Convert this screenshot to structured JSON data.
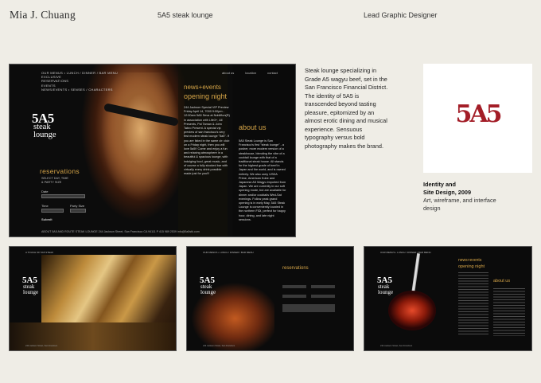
{
  "header": {
    "name": "Mia J. Chuang",
    "project": "5A5 steak lounge",
    "role": "Lead Graphic Designer"
  },
  "main_screenshot": {
    "nav_items": [
      "OUR MENUS  •  LUNCH / DINNER / BAR MENU",
      "EXCLUSIVE",
      "RESERVATIONS",
      "EVENTS",
      "NEWS/EVENTS  •  SENSES / CHARACTERS"
    ],
    "nav_right": [
      "about us",
      "location",
      "contact"
    ],
    "logo_mark": "5A5",
    "logo_word_1": "steak",
    "logo_word_2": "lounge",
    "reservations_title": "reservations",
    "reservations_sub_1": "SELECT DAY, TIME",
    "reservations_sub_2": "& PARTY SIZE",
    "field_date": "Date",
    "field_time": "Time",
    "field_party": "Party Size",
    "submit": "Submit",
    "news_title": "news+events",
    "news_subtitle": "opening night",
    "news_body": "244 Jackson Special VIP Preview Friday April 14, 7000 9:00pm - 12:00am 5A5 Seva at Noblifton(R) in association with Life3+, All Presents, Pal Taman & John Tabro Present. A special vip preview of san francisco's very first modern steak lounge \"5a5\". If you are listed in the same clr: club on a Friday night, then you will love 5a5!! Come and enjoy a fun and relaxing atmosphere in a beautiful & spacious lounge, with indulging food, great music, and of course a fully stocked bar with virtually every drink possible made just for you!!!",
    "about_title": "about us",
    "about_body": "5A5 Steak Lounge is San Francisco's first \"steak lounge\" - a posher, more modern version of a steakhouse, blending the vibe of a cocktail lounge with that of a traditional steak house. All stands for the highest grade of beef in Japan and the world, and is owned entirely. We also carry USDA Prime, American Kobe and Japanese A5 Wagyu imported from Japan. We are currently in our soft opening mode, but are available for dinner and/or cocktails Wed-Sat evenings. Follow peak grand opening is in early May, 5A5 Steak Lounge is conveniently located in the northern FiDi, perfect for happy hour, dining, and late night sessions.",
    "footer": "ABOUT 5A5 AND ROUTE STEAK LOUNGE   244 Jackson Street, San Francisco CA 94111   P 415 989 2539   info@5a5stk.com"
  },
  "description": "Steak lounge specializing in Grade A5 wagyu beef, set in the San Francisco Financial District. The identity of 5A5 is transcended beyond tasting pleasure, epitomized by an almost erotic dining and musical experience. Sensuous typography versus bold photography makes the brand.",
  "logo_card": {
    "mark": "5A5"
  },
  "identity": {
    "title_1": "Identity and",
    "title_2": "Site Design, 2009",
    "subtitle": "Art, wireframe, and interface design"
  },
  "thumbnails": [
    {
      "nav": "A TOUCH OF 5A5 STEAK",
      "logo": "5A5",
      "w1": "steak",
      "w2": "lounge",
      "foot": "244 Jackson Street, San Francisco"
    },
    {
      "nav": "OUR MENUS  •  LUNCH / DINNER / BAR MENU",
      "logo": "5A5",
      "w1": "steak",
      "w2": "lounge",
      "res_title": "reservations",
      "foot": "244 Jackson Street, San Francisco"
    },
    {
      "nav": "OUR MENUS  •  LUNCH / DINNER / BAR MENU",
      "logo": "5A5",
      "w1": "steak",
      "w2": "lounge",
      "news": "news+events",
      "news_sub": "opening night",
      "about": "about us",
      "foot": "244 Jackson Street, San Francisco"
    }
  ],
  "colors": {
    "page_bg": "#efede6",
    "accent_gold": "#d7a648",
    "brand_red": "#a31d27"
  }
}
